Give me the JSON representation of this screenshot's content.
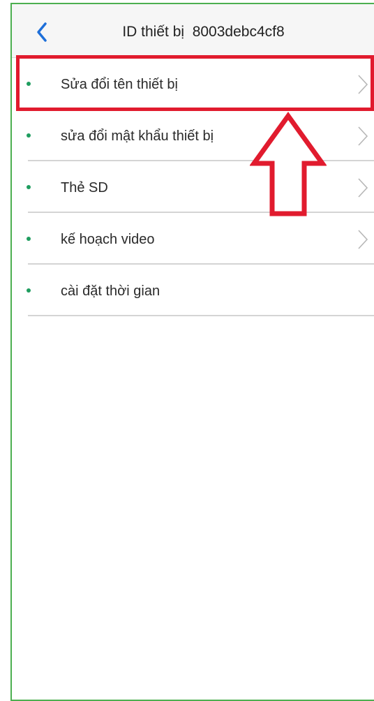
{
  "header": {
    "back_icon": "chevron-left-icon",
    "title": "ID thiết bị  8003debc4cf8"
  },
  "settings": {
    "items": [
      {
        "label": "Sửa đổi tên thiết bị",
        "has_chevron": true
      },
      {
        "label": "sửa đổi mật khẩu thiết bị",
        "has_chevron": true
      },
      {
        "label": "Thẻ SD",
        "has_chevron": true
      },
      {
        "label": "kế hoạch video",
        "has_chevron": true
      },
      {
        "label": "cài đặt thời gian",
        "has_chevron": false
      }
    ]
  },
  "annotation": {
    "highlight_color": "#e11b2e",
    "arrow_direction": "up",
    "highlighted_item": "Sửa đổi tên thiết bị"
  },
  "colors": {
    "accent_blue": "#1e6fd9",
    "bullet_green": "#1f9d5f",
    "frame_green": "#4caf50"
  }
}
